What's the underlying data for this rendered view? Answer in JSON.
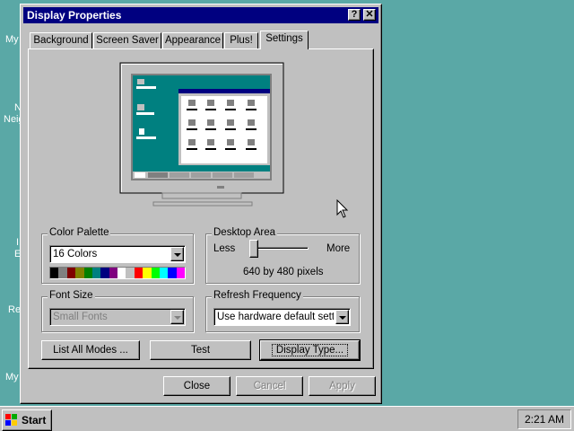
{
  "desktop": {
    "labels": [
      "My",
      "N",
      "Neig",
      "I",
      "E",
      "Re",
      "My"
    ]
  },
  "dialog": {
    "title": "Display Properties",
    "help_button": "?",
    "close_button": "✕",
    "tabs": [
      {
        "label": "Background",
        "active": false
      },
      {
        "label": "Screen Saver",
        "active": false
      },
      {
        "label": "Appearance",
        "active": false
      },
      {
        "label": "Plus!",
        "active": false
      },
      {
        "label": "Settings",
        "active": true
      }
    ],
    "color_palette": {
      "label": "Color Palette",
      "value": "16 Colors",
      "swatches": [
        "#000000",
        "#808080",
        "#800000",
        "#808000",
        "#008000",
        "#008080",
        "#000080",
        "#800080",
        "#ffffff",
        "#c0c0c0",
        "#ff0000",
        "#ffff00",
        "#00ff00",
        "#00ffff",
        "#0000ff",
        "#ff00ff"
      ]
    },
    "desktop_area": {
      "label": "Desktop Area",
      "less": "Less",
      "more": "More",
      "resolution": "640 by 480 pixels",
      "slider_position": 0
    },
    "font_size": {
      "label": "Font Size",
      "value": "Small Fonts",
      "disabled": true
    },
    "refresh_frequency": {
      "label": "Refresh Frequency",
      "value": "Use hardware default setting"
    },
    "buttons": {
      "list_modes": "List All Modes ...",
      "test": "Test",
      "display_type": "Display Type...",
      "close": "Close",
      "cancel": "Cancel",
      "apply": "Apply"
    }
  },
  "taskbar": {
    "start": "Start",
    "clock": "2:21 AM"
  },
  "colors": {
    "desktop": "#5aa8a6",
    "titlebar": "#000080",
    "face": "#c0c0c0"
  }
}
